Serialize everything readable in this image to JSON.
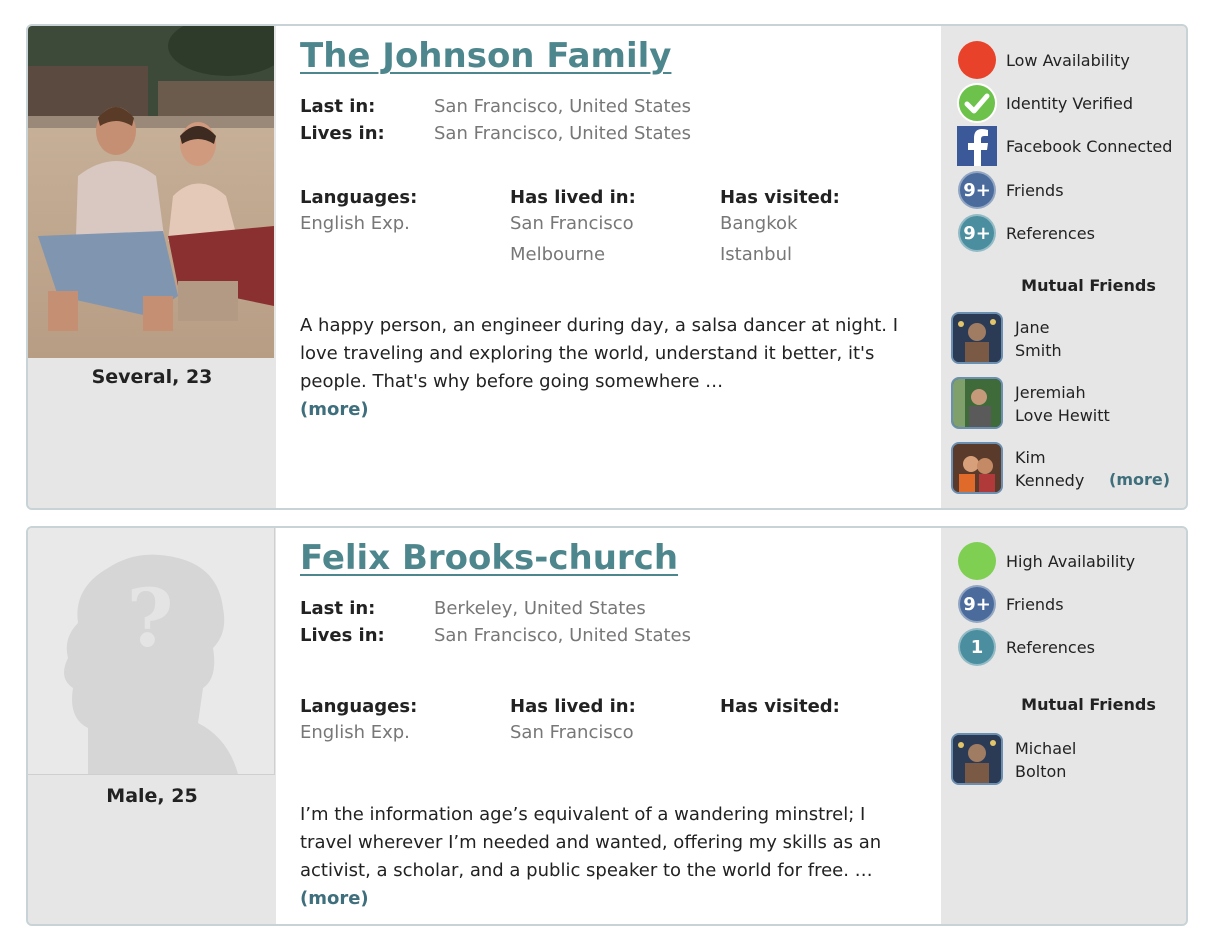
{
  "profiles": [
    {
      "name": "The Johnson Family",
      "caption": "Several, 23",
      "last_in_label": "Last in:",
      "last_in": "San Francisco, United States",
      "lives_in_label": "Lives in:",
      "lives_in": "San Francisco, United States",
      "languages_label": "Languages:",
      "languages": [
        "English Exp."
      ],
      "lived_label": "Has lived in:",
      "lived": [
        "San Francisco",
        "Melbourne"
      ],
      "visited_label": "Has visited:",
      "visited": [
        "Bangkok",
        "Istanbul"
      ],
      "bio": "A happy person, an engineer during day, a salsa dancer at night. I love traveling and exploring the world, understand it better, it's people. That's why before going somewhere …",
      "more": "(more)",
      "availability": {
        "label": "Low Availability",
        "color": "#e8432a"
      },
      "identity": "Identity Verified",
      "facebook": "Facebook Connected",
      "friends": {
        "count": "9+",
        "label": "Friends",
        "color": "#4a6b9c"
      },
      "references": {
        "count": "9+",
        "label": "References",
        "color": "#4a8ea0"
      },
      "mutual_title": "Mutual Friends",
      "mutual": [
        {
          "first": "Jane",
          "last": "Smith"
        },
        {
          "first": "Jeremiah",
          "last": "Love Hewitt"
        },
        {
          "first": "Kim",
          "last": "Kennedy"
        }
      ],
      "mutual_more": "(more)"
    },
    {
      "name": "Felix Brooks-church",
      "caption": "Male, 25",
      "last_in_label": "Last in:",
      "last_in": "Berkeley, United States",
      "lives_in_label": "Lives in:",
      "lives_in": "San Francisco, United States",
      "languages_label": "Languages:",
      "languages": [
        "English Exp."
      ],
      "lived_label": "Has lived in:",
      "lived": [
        "San Francisco"
      ],
      "visited_label": "Has visited:",
      "visited": [],
      "bio": "I’m the information age’s equivalent of a wandering minstrel; I travel wherever I’m needed and wanted, offering my skills as an activist, a scholar, and a public speaker to the world for free. …",
      "more": "(more)",
      "availability": {
        "label": "High Availability",
        "color": "#7fcf52"
      },
      "friends": {
        "count": "9+",
        "label": "Friends",
        "color": "#4a6b9c"
      },
      "references": {
        "count": "1",
        "label": "References",
        "color": "#4a8ea0"
      },
      "mutual_title": "Mutual Friends",
      "mutual": [
        {
          "first": "Michael",
          "last": "Bolton"
        }
      ]
    }
  ],
  "icons": {
    "availability": "status-dot-icon",
    "identity": "checkmark-icon",
    "facebook": "facebook-icon",
    "friends": "friends-count-icon",
    "references": "references-count-icon",
    "placeholder": "question-silhouette-icon"
  }
}
